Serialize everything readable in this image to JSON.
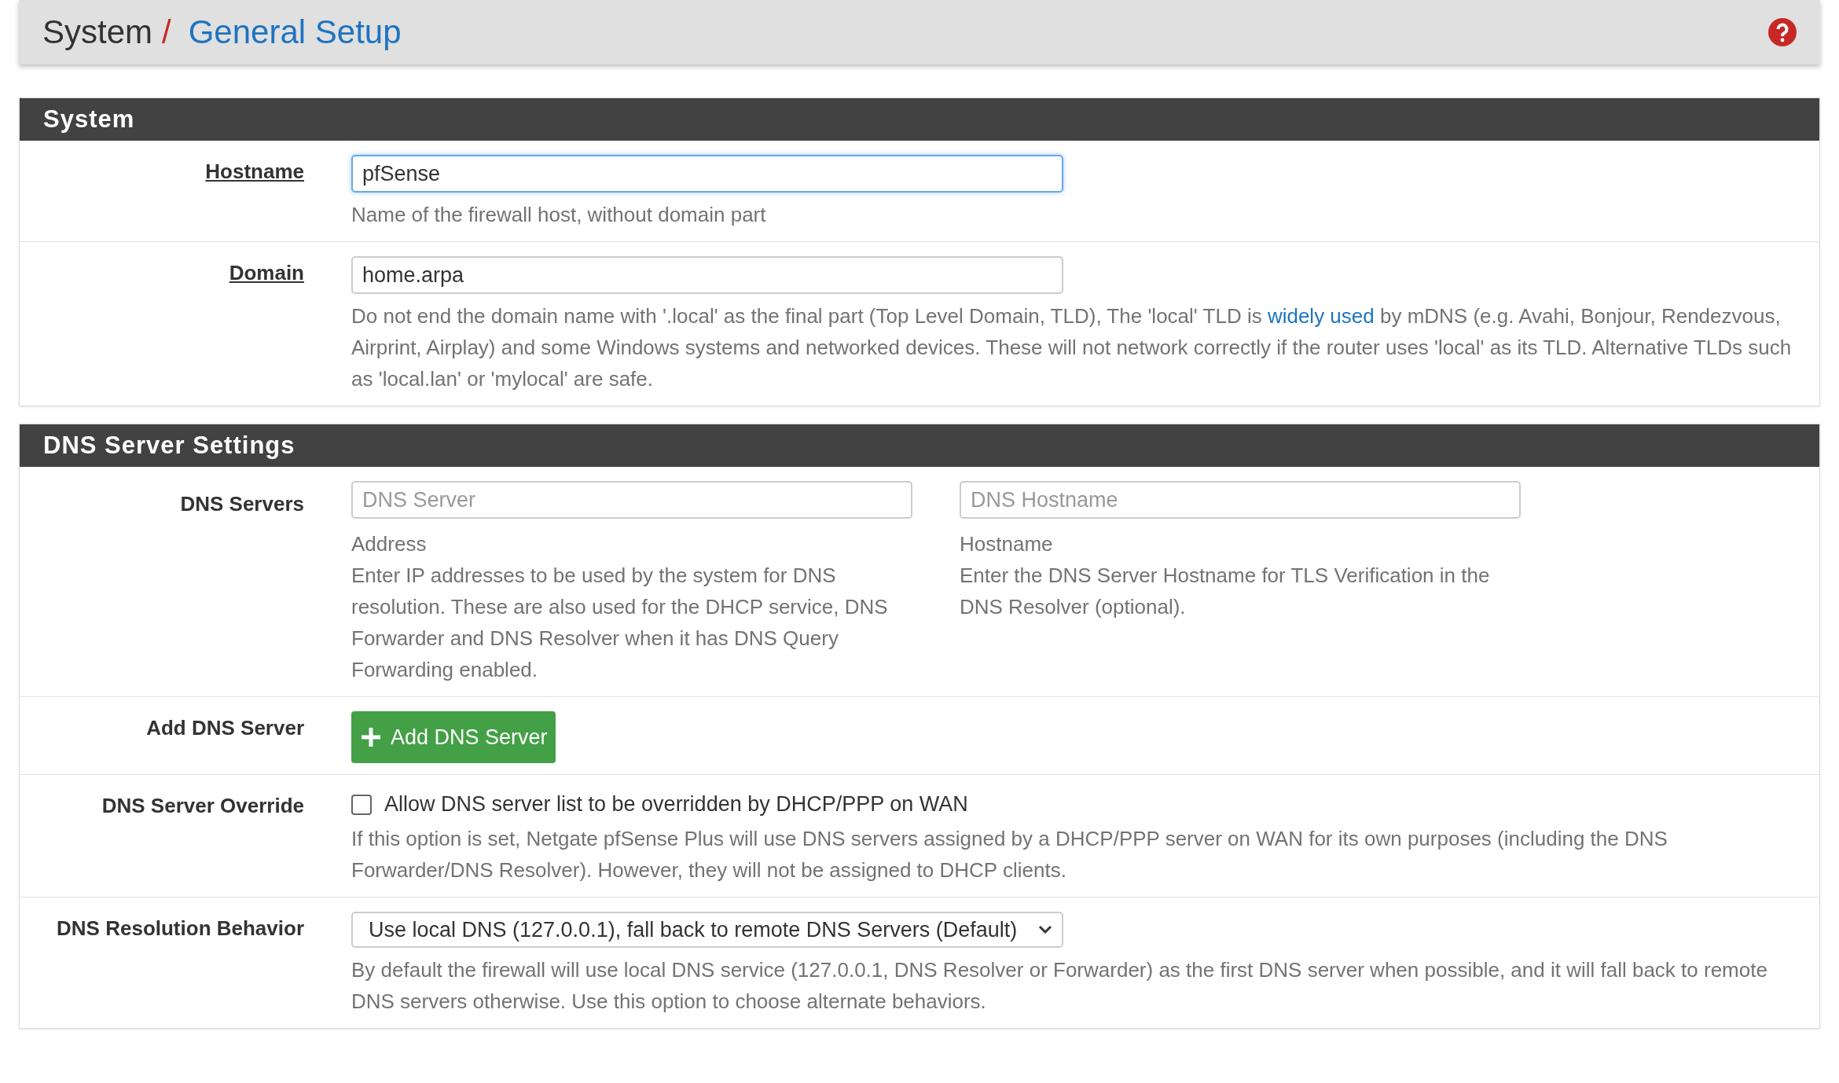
{
  "breadcrumb": {
    "parent": "System",
    "separator": "/",
    "current": "General Setup"
  },
  "sections": [
    {
      "title": "System",
      "rows": [
        {
          "kind": "input",
          "label": "Hostname",
          "required": true,
          "value": "pfSense",
          "focused": true,
          "help": [
            {
              "text": "Name of the firewall host, without domain part",
              "link": false
            }
          ]
        },
        {
          "kind": "input",
          "label": "Domain",
          "required": true,
          "value": "home.arpa",
          "focused": false,
          "help": [
            {
              "text": "Do not end the domain name with '.local' as the final part (Top Level Domain, TLD), The 'local' TLD is ",
              "link": false
            },
            {
              "text": "widely used",
              "link": true
            },
            {
              "text": " by mDNS (e.g. Avahi, Bonjour, Rendezvous, Airprint, Airplay) and some Windows systems and networked devices. These will not network correctly if the router uses 'local' as its TLD. Alternative TLDs such as 'local.lan' or 'mylocal' are safe.",
              "link": false
            }
          ]
        }
      ]
    },
    {
      "title": "DNS Server Settings",
      "rows": [
        {
          "kind": "dual-input",
          "label": "DNS Servers",
          "required": false,
          "fields": [
            {
              "placeholder": "DNS Server",
              "caption": "Address",
              "help": "Enter IP addresses to be used by the system for DNS resolution. These are also used for the DHCP service, DNS Forwarder and DNS Resolver when it has DNS Query Forwarding enabled."
            },
            {
              "placeholder": "DNS Hostname",
              "caption": "Hostname",
              "help": "Enter the DNS Server Hostname for TLS Verification in the DNS Resolver (optional)."
            }
          ]
        },
        {
          "kind": "button",
          "label": "Add DNS Server",
          "required": false,
          "button": "Add DNS Server"
        },
        {
          "kind": "checkbox",
          "label": "DNS Server Override",
          "required": false,
          "checked": false,
          "text": "Allow DNS server list to be overridden by DHCP/PPP on WAN",
          "help": [
            {
              "text": "If this option is set, Netgate pfSense Plus will use DNS servers assigned by a DHCP/PPP server on WAN for its own purposes (including the DNS Forwarder/DNS Resolver). However, they will not be assigned to DHCP clients.",
              "link": false
            }
          ]
        },
        {
          "kind": "select",
          "label": "DNS Resolution Behavior",
          "required": false,
          "value": "Use local DNS (127.0.0.1), fall back to remote DNS Servers (Default)",
          "help": [
            {
              "text": "By default the firewall will use local DNS service (127.0.0.1, DNS Resolver or Forwarder) as the first DNS server when possible, and it will fall back to remote DNS servers otherwise. Use this option to choose alternate behaviors.",
              "link": false
            }
          ]
        }
      ]
    }
  ]
}
